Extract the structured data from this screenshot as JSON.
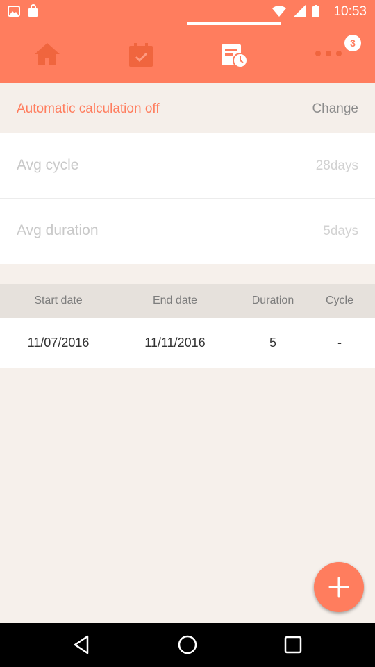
{
  "status_bar": {
    "time": "10:53"
  },
  "tabs": [
    {
      "icon": "home-icon",
      "active": false
    },
    {
      "icon": "calendar-check-icon",
      "active": false
    },
    {
      "icon": "calendar-clock-icon",
      "active": true
    },
    {
      "icon": "more-dots-icon",
      "active": false,
      "badge": "3"
    }
  ],
  "calculation": {
    "label": "Automatic calculation off",
    "action": "Change"
  },
  "stats": {
    "avg_cycle": {
      "label": "Avg cycle",
      "value": "28days"
    },
    "avg_duration": {
      "label": "Avg duration",
      "value": "5days"
    }
  },
  "table": {
    "headers": [
      "Start date",
      "End date",
      "Duration",
      "Cycle"
    ],
    "rows": [
      [
        "11/07/2016",
        "11/11/2016",
        "5",
        "-"
      ]
    ]
  },
  "colors": {
    "accent": "#ff7d5e",
    "background": "#f6f0eb"
  }
}
